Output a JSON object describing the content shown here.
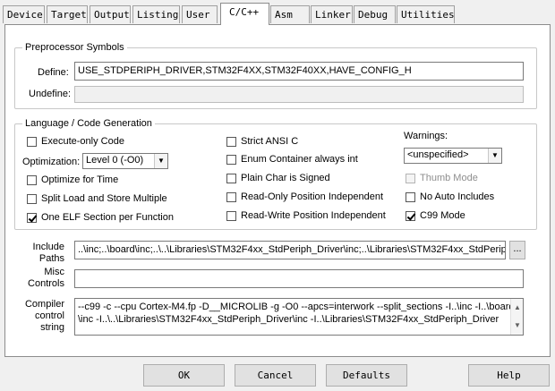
{
  "tabs": [
    "Device",
    "Target",
    "Output",
    "Listing",
    "User",
    "C/C++",
    "Asm",
    "Linker",
    "Debug",
    "Utilities"
  ],
  "preprocessor": {
    "title": "Preprocessor Symbols",
    "define_label": "Define:",
    "define_value": "USE_STDPERIPH_DRIVER,STM32F4XX,STM32F40XX,HAVE_CONFIG_H",
    "undefine_label": "Undefine:",
    "undefine_value": ""
  },
  "language": {
    "title": "Language / Code Generation",
    "execute_only": "Execute-only Code",
    "optimization_label": "Optimization:",
    "optimization_value": "Level 0 (-O0)",
    "optimize_time": "Optimize for Time",
    "split_load": "Split Load and Store Multiple",
    "one_elf": "One ELF Section per Function",
    "strict_ansi": "Strict ANSI C",
    "enum_container": "Enum Container always int",
    "plain_char": "Plain Char is Signed",
    "ro_pos": "Read-Only Position Independent",
    "rw_pos": "Read-Write Position Independent",
    "warnings_label": "Warnings:",
    "warnings_value": "<unspecified>",
    "thumb_mode": "Thumb Mode",
    "no_auto_includes": "No Auto Includes",
    "c99_mode": "C99 Mode"
  },
  "include": {
    "label_line1": "Include",
    "label_line2": "Paths",
    "value": "..\\inc;..\\board\\inc;..\\..\\Libraries\\STM32F4xx_StdPeriph_Driver\\inc;..\\Libraries\\STM32F4xx_StdPerip",
    "browse": "..."
  },
  "misc": {
    "label_line1": "Misc",
    "label_line2": "Controls",
    "value": ""
  },
  "compiler": {
    "label_line1": "Compiler",
    "label_line2": "control",
    "label_line3": "string",
    "line1": "--c99 -c --cpu Cortex-M4.fp -D__MICROLIB -g -O0 --apcs=interwork --split_sections -I..\\inc -I..\\board",
    "line2": "\\inc -I..\\..\\Libraries\\STM32F4xx_StdPeriph_Driver\\inc -I..\\Libraries\\STM32F4xx_StdPeriph_Driver"
  },
  "buttons": {
    "ok": "OK",
    "cancel": "Cancel",
    "defaults": "Defaults",
    "help": "Help"
  }
}
